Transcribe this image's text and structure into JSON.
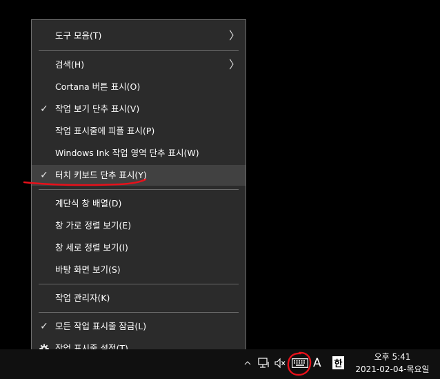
{
  "menu": {
    "toolbar": "도구 모음(T)",
    "search": "검색(H)",
    "cortana": "Cortana 버튼 표시(O)",
    "task_view": "작업 보기 단추 표시(V)",
    "people": "작업 표시줄에 피플 표시(P)",
    "ink": "Windows Ink 작업 영역 단추 표시(W)",
    "touch_keyboard": "터치 키보드 단추 표시(Y)",
    "cascade": "계단식 창 배열(D)",
    "stack": "창 가로 정렬 보기(E)",
    "side_by_side": "창 세로 정렬 보기(I)",
    "desktop": "바탕 화면 보기(S)",
    "task_manager": "작업 관리자(K)",
    "lock": "모든 작업 표시줄 잠금(L)",
    "settings": "작업 표시줄 설정(T)",
    "check_glyph": "✓",
    "arrow_glyph": "〉"
  },
  "taskbar": {
    "ime_mode": "A",
    "ime_lang": "한",
    "time": "오후 5:41",
    "date": "2021-02-04-목요일"
  },
  "icons": [
    "chevron-right-icon",
    "checkmark-icon",
    "gear-icon",
    "network-icon",
    "speaker-muted-icon",
    "keyboard-icon"
  ],
  "colors": {
    "menu_bg": "#2b2b2b",
    "hover_bg": "#414141",
    "annotation": "#e8101a"
  }
}
